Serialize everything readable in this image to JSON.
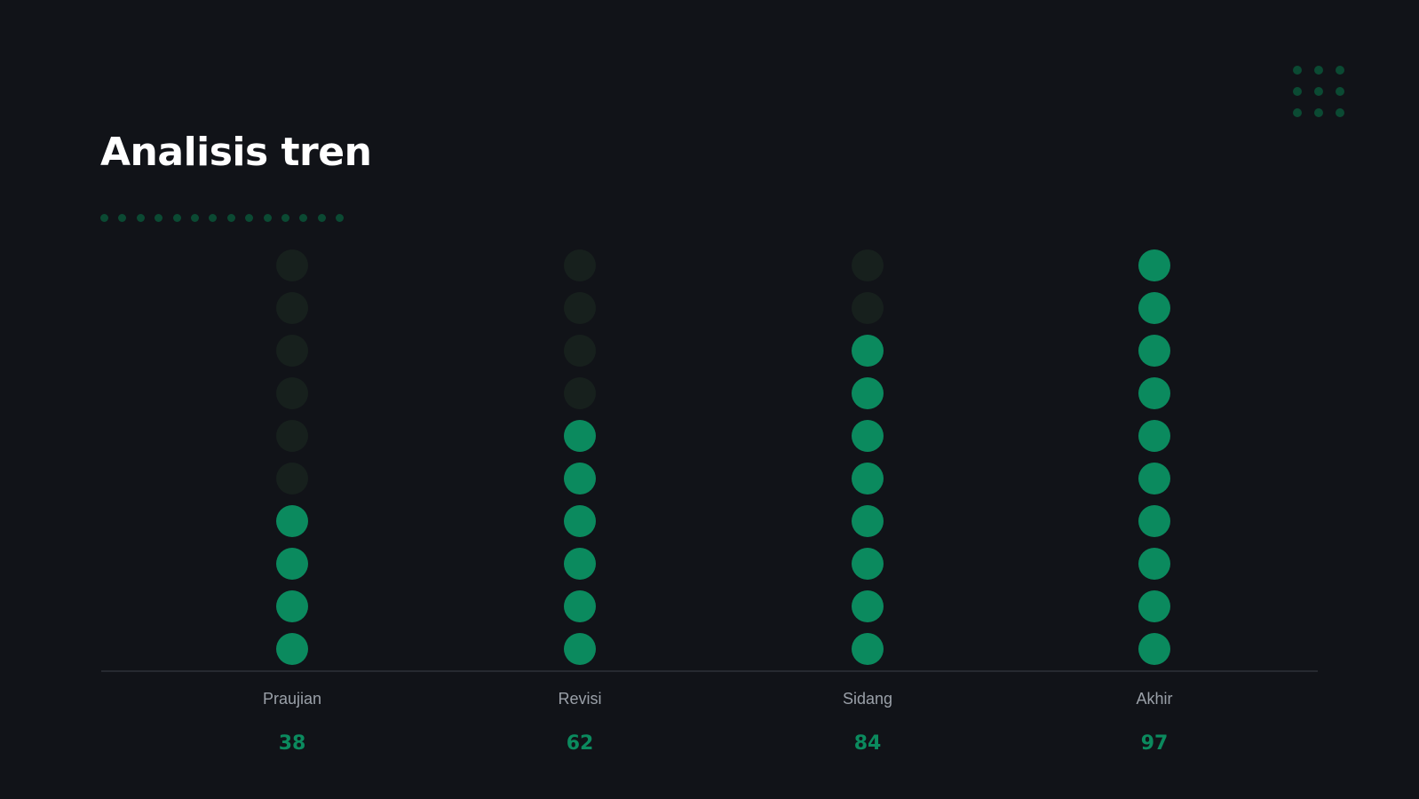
{
  "title": "Analisis tren",
  "colors": {
    "background": "#111318",
    "filled_dot": "#0b8a5e",
    "empty_dot": "#17201d",
    "decor_dot": "#0b4a33",
    "axis_line": "#3a3f47",
    "category_text": "#9aa0a8",
    "value_text": "#0b8a5e",
    "title_text": "#ffffff"
  },
  "chart_data": {
    "type": "bar",
    "style": "dot-column",
    "title": "Analisis tren",
    "xlabel": "",
    "ylabel": "",
    "categories": [
      "Praujian",
      "Revisi",
      "Sidang",
      "Akhir"
    ],
    "values": [
      38,
      62,
      84,
      97
    ],
    "value_labels": [
      "38",
      "62",
      "84",
      "97"
    ],
    "dots_per_column": 10,
    "ylim": [
      0,
      100
    ],
    "grid": false,
    "legend": "none"
  }
}
